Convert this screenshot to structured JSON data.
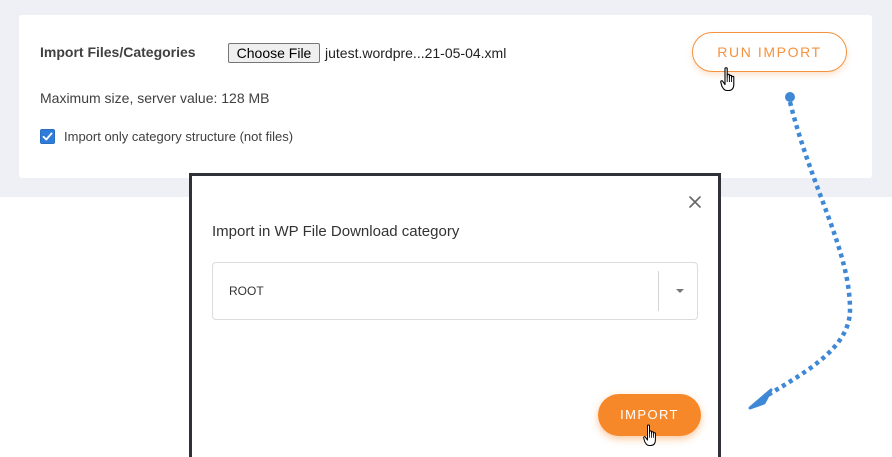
{
  "import_panel": {
    "label": "Import Files/Categories",
    "choose_file_label": "Choose File",
    "file_name": "jutest.wordpre...21-05-04.xml",
    "max_size_text": "Maximum size, server value: 128 MB",
    "checkbox_label": "Import only category structure (not files)",
    "checkbox_checked": true,
    "run_import_label": "RUN IMPORT"
  },
  "modal": {
    "title": "Import in WP File Download category",
    "select_value": "ROOT",
    "import_label": "IMPORT"
  },
  "colors": {
    "accent_orange": "#f7882a",
    "checkbox_blue": "#2f7cd8",
    "arrow_blue": "#3f88d6"
  },
  "icons": [
    "close-icon",
    "chevron-down-icon",
    "check-icon",
    "hand-cursor-icon"
  ]
}
